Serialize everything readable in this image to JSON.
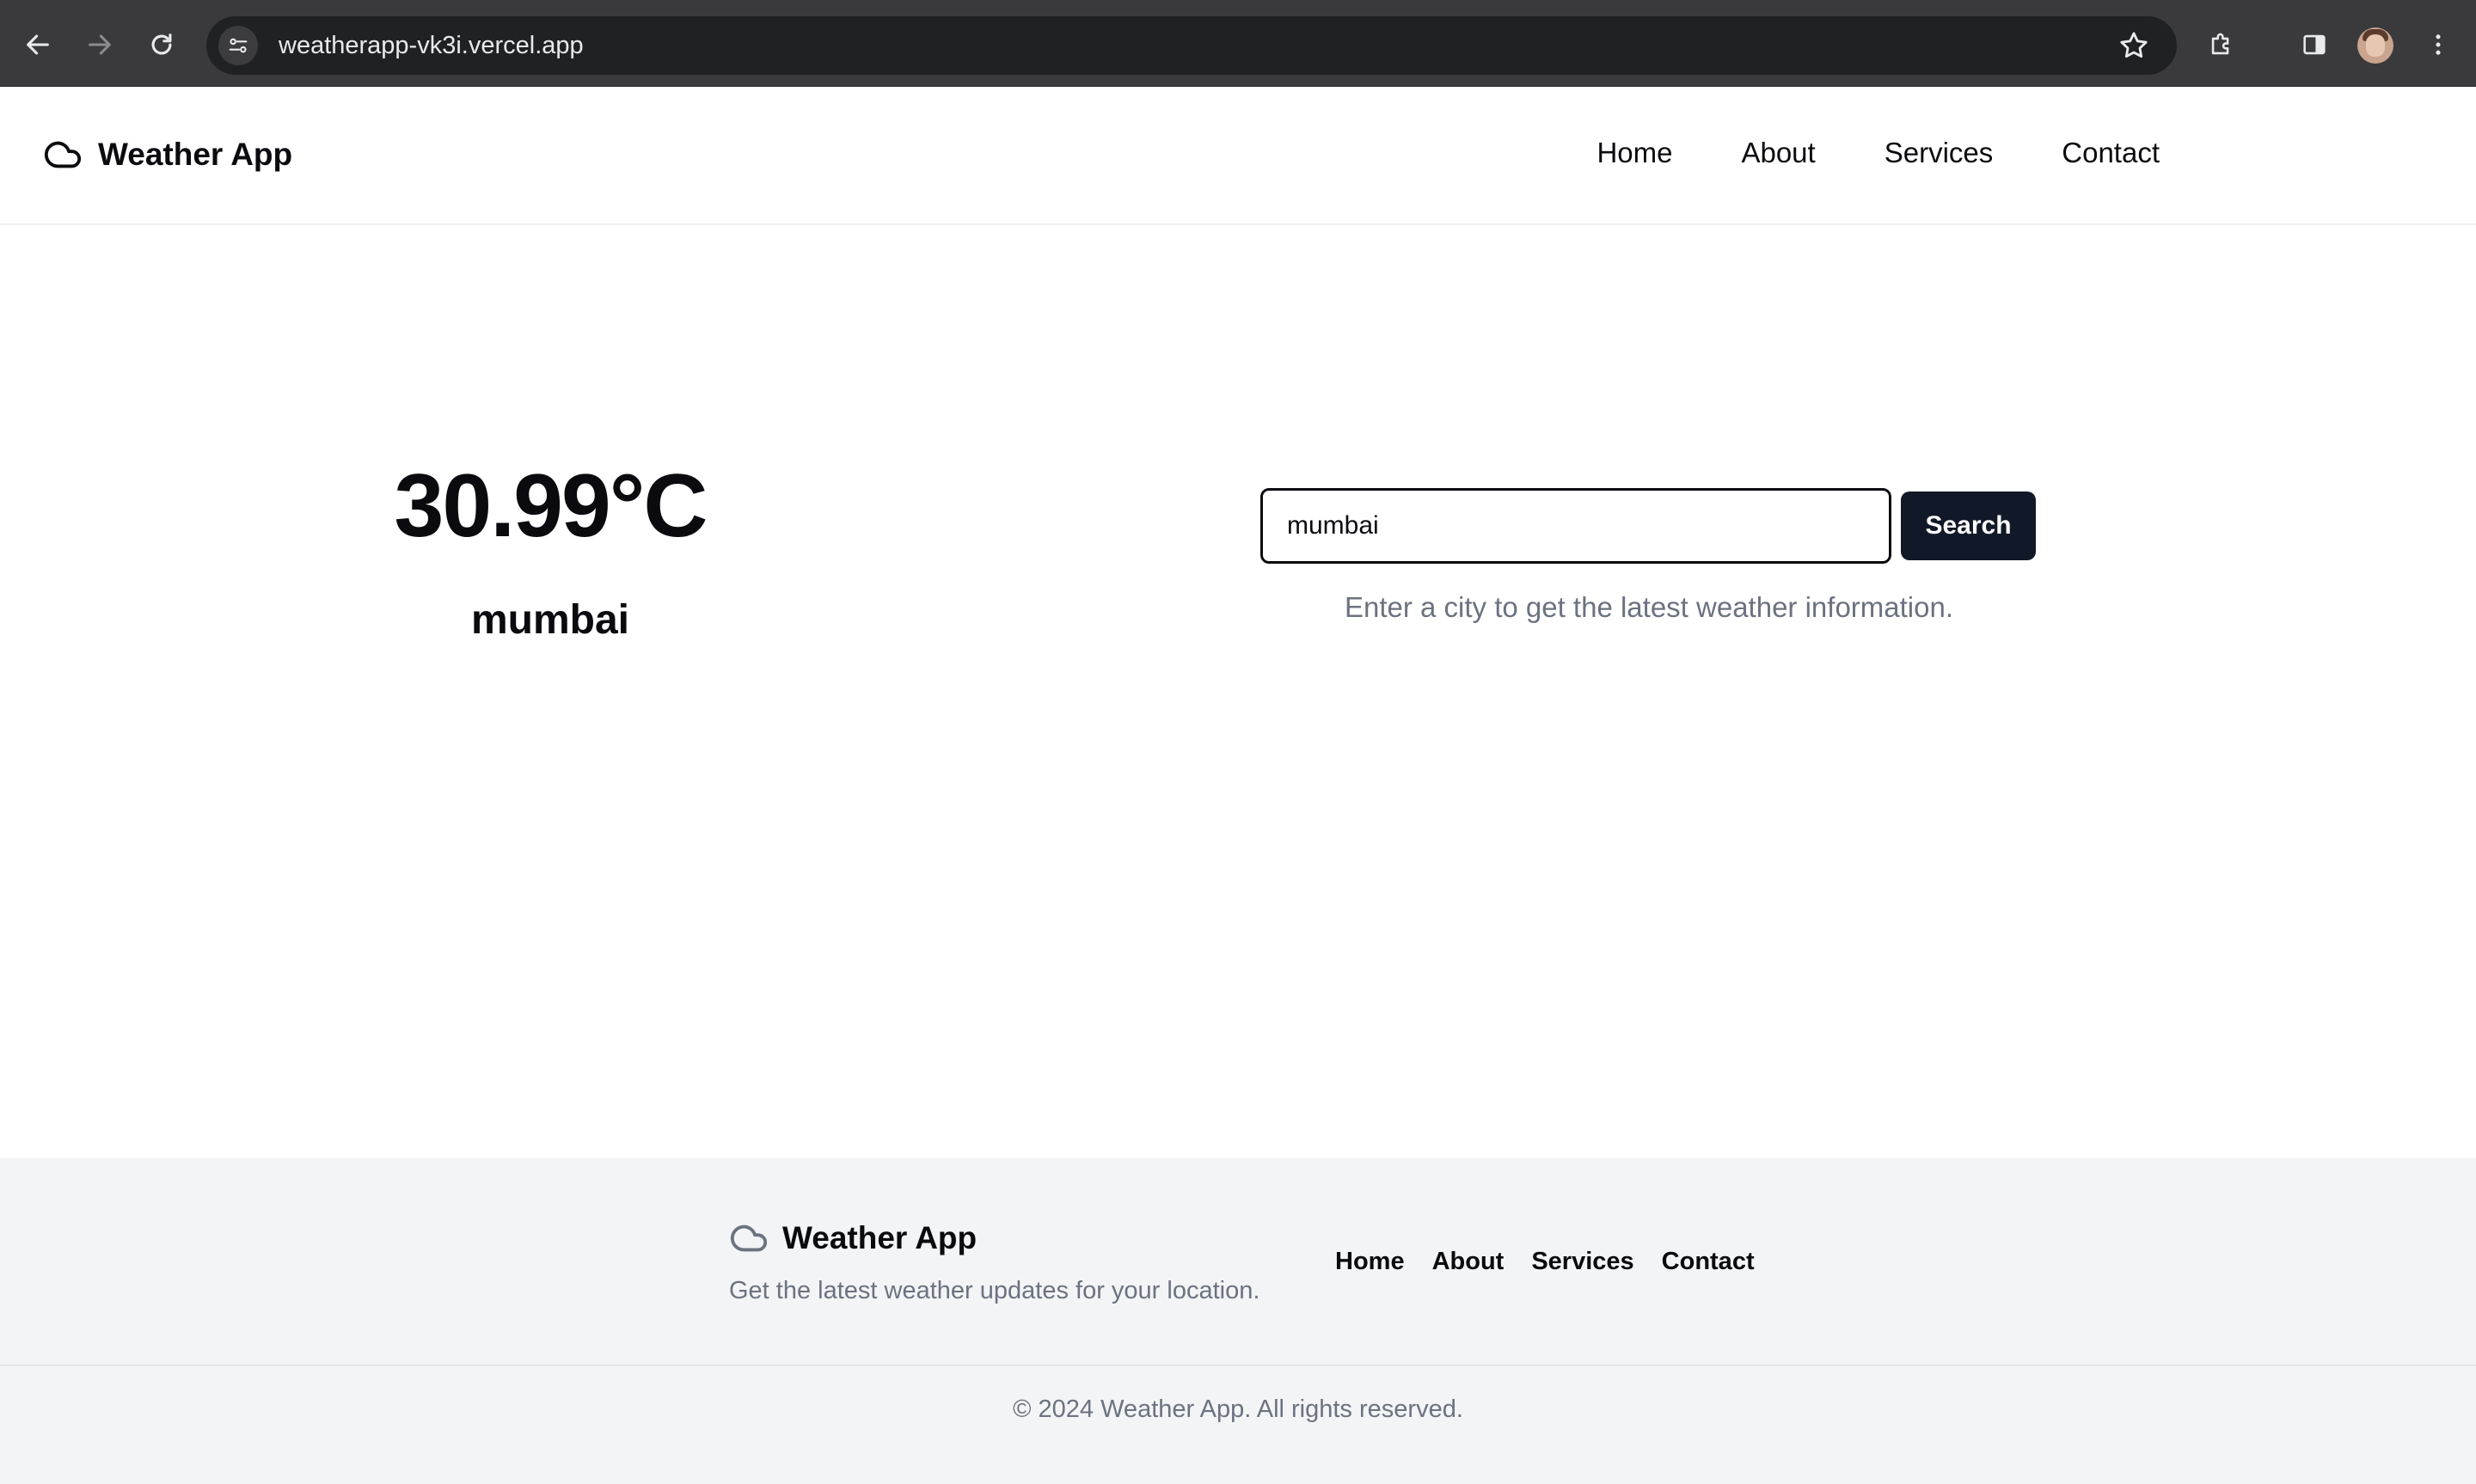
{
  "browser": {
    "url": "weatherapp-vk3i.vercel.app"
  },
  "header": {
    "brand": "Weather App",
    "nav": [
      "Home",
      "About",
      "Services",
      "Contact"
    ]
  },
  "weather": {
    "temperature": "30.99°C",
    "city": "mumbai"
  },
  "search": {
    "value": "mumbai",
    "button_label": "Search",
    "hint": "Enter a city to get the latest weather information."
  },
  "footer": {
    "brand": "Weather App",
    "tagline": "Get the latest weather updates for your location.",
    "nav": [
      "Home",
      "About",
      "Services",
      "Contact"
    ],
    "copyright": "© 2024 Weather App. All rights reserved."
  },
  "colors": {
    "primary_button": "#111827",
    "muted_text": "#6b7280",
    "footer_bg": "#f3f4f6",
    "chrome_bg": "#3a3a3c"
  },
  "icons": {
    "brand": "cloud-icon",
    "chrome": [
      "back-arrow-icon",
      "forward-arrow-icon",
      "reload-icon",
      "site-info-icon",
      "star-icon",
      "extensions-icon",
      "side-panel-icon",
      "avatar",
      "more-vert-icon"
    ]
  }
}
